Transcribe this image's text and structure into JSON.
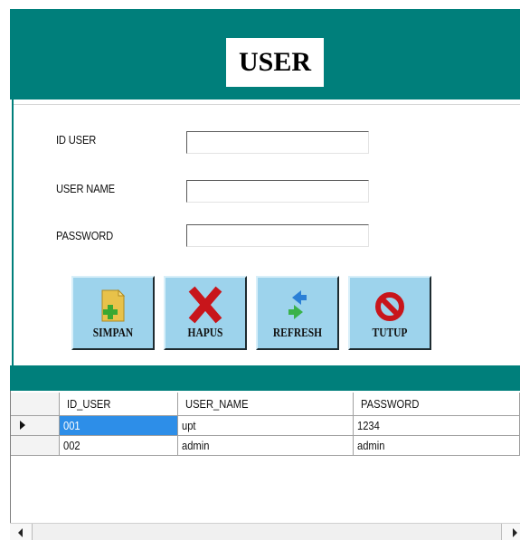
{
  "window": {
    "title": "USER",
    "colors": {
      "header": "#007f7b",
      "button": "#9dd3ec",
      "selection": "#2d8ee8"
    }
  },
  "form": {
    "fields": [
      {
        "label": "ID USER",
        "value": ""
      },
      {
        "label": "USER NAME",
        "value": ""
      },
      {
        "label": "PASSWORD",
        "value": ""
      }
    ]
  },
  "buttons": [
    {
      "label": "SIMPAN",
      "icon": "add-file-icon"
    },
    {
      "label": "HAPUS",
      "icon": "red-x-icon"
    },
    {
      "label": "REFRESH",
      "icon": "refresh-arrows-icon"
    },
    {
      "label": "TUTUP",
      "icon": "no-entry-icon"
    }
  ],
  "grid": {
    "columns": [
      "ID_USER",
      "USER_NAME",
      "PASSWORD"
    ],
    "rows": [
      {
        "id_user": "001",
        "user_name": "upt",
        "password": "1234",
        "selected": true
      },
      {
        "id_user": "002",
        "user_name": "admin",
        "password": "admin",
        "selected": false
      }
    ]
  }
}
